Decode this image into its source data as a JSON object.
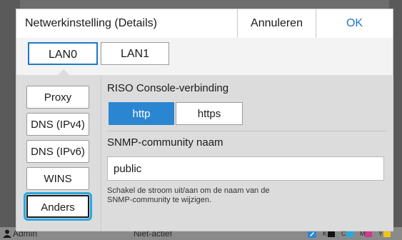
{
  "dialog": {
    "title": "Netwerkinstelling (Details)",
    "cancel_label": "Annuleren",
    "ok_label": "OK"
  },
  "lan_tabs": [
    {
      "label": "LAN0",
      "selected": true
    },
    {
      "label": "LAN1",
      "selected": false
    }
  ],
  "sidebar": {
    "items": [
      {
        "label": "Proxy"
      },
      {
        "label": "DNS (IPv4)"
      },
      {
        "label": "DNS (IPv6)"
      },
      {
        "label": "WINS"
      },
      {
        "label": "Anders",
        "selected": true
      }
    ]
  },
  "content": {
    "riso_label": "RISO Console-verbinding",
    "protocols": [
      {
        "label": "http",
        "selected": true
      },
      {
        "label": "https",
        "selected": false
      }
    ],
    "snmp_label": "SNMP-community naam",
    "snmp_value": "public",
    "note": "Schakel de stroom uit/aan om de naam van de SNMP-community te wijzigen."
  },
  "background_status": {
    "user": "Admin",
    "state": "Niet-actief",
    "ink_labels": [
      "K",
      "C",
      "M",
      "Y"
    ]
  },
  "colors": {
    "accent": "#1e78c8",
    "selected_fill": "#2b86d2",
    "focus_ring": "#29a8e0",
    "panel_bg": "#dcdcdc"
  }
}
